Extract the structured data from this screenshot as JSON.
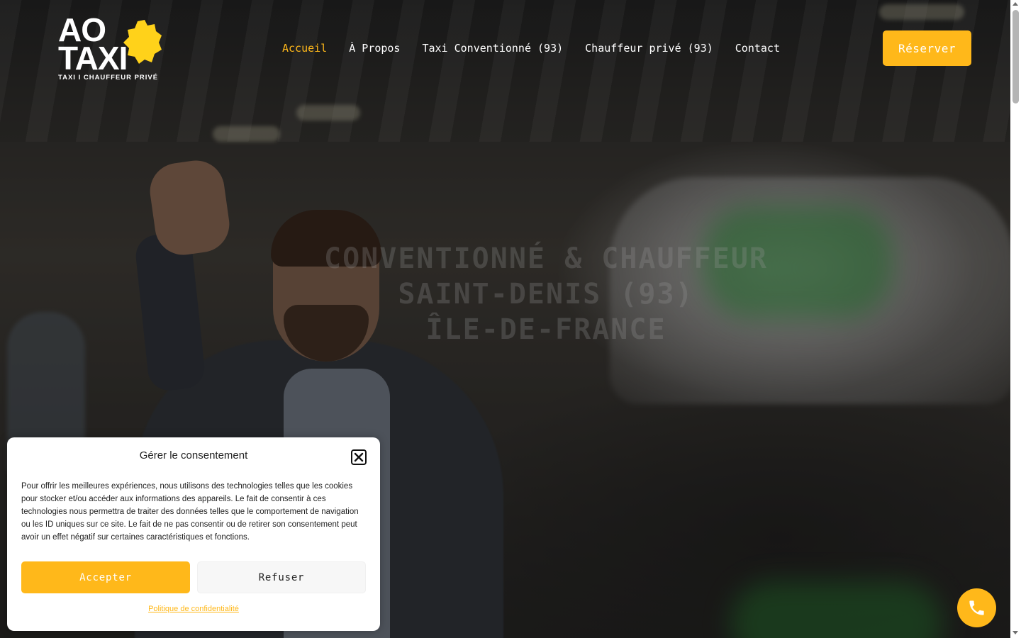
{
  "colors": {
    "accent": "#ffb81a",
    "nav_text": "#ffffff",
    "modal_bg": "#ffffff",
    "refuse_bg": "#f7f7f7"
  },
  "logo": {
    "line1": "AO",
    "line2": "TAXI",
    "tagline": "TAXI I CHAUFFEUR PRIVÉ",
    "map_icon": "ile-de-france-map-icon"
  },
  "nav": {
    "items": [
      {
        "label": "Accueil",
        "active": true
      },
      {
        "label": "À Propos",
        "active": false
      },
      {
        "label": "Taxi Conventionné (93)",
        "active": false
      },
      {
        "label": "Chauffeur privé (93)",
        "active": false
      },
      {
        "label": "Contact",
        "active": false
      }
    ]
  },
  "header": {
    "reserve_label": "Réserver"
  },
  "hero": {
    "title_line1": "CONVENTIONNÉ & CHAUFFEUR",
    "title_line2": "SAINT-DENIS (93)",
    "title_line3": "ÎLE-DE-FRANCE"
  },
  "consent": {
    "title": "Gérer le consentement",
    "body": "Pour offrir les meilleures expériences, nous utilisons des technologies telles que les cookies pour stocker et/ou accéder aux informations des appareils. Le fait de consentir à ces technologies nous permettra de traiter des données telles que le comportement de navigation ou les ID uniques sur ce site. Le fait de ne pas consentir ou de retirer son consentement peut avoir un effet négatif sur certaines caractéristiques et fonctions.",
    "accept_label": "Accepter",
    "refuse_label": "Refuser",
    "privacy_label": "Politique de confidentialité",
    "close_icon": "close-icon"
  },
  "call": {
    "icon": "phone-icon"
  }
}
